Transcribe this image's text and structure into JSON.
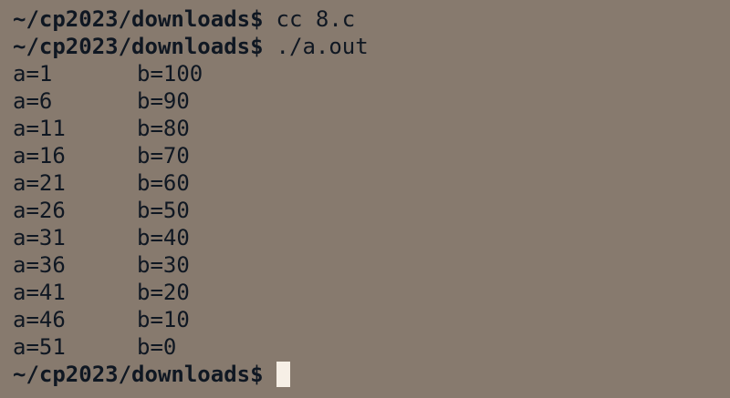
{
  "terminal": {
    "prompt": "~/cp2023/downloads$",
    "commands": [
      "cc 8.c",
      "./a.out"
    ],
    "output": [
      {
        "a": "a=1",
        "b": "b=100"
      },
      {
        "a": "a=6",
        "b": "b=90"
      },
      {
        "a": "a=11",
        "b": "b=80"
      },
      {
        "a": "a=16",
        "b": "b=70"
      },
      {
        "a": "a=21",
        "b": "b=60"
      },
      {
        "a": "a=26",
        "b": "b=50"
      },
      {
        "a": "a=31",
        "b": "b=40"
      },
      {
        "a": "a=36",
        "b": "b=30"
      },
      {
        "a": "a=41",
        "b": "b=20"
      },
      {
        "a": "a=46",
        "b": "b=10"
      },
      {
        "a": "a=51",
        "b": "b=0"
      }
    ]
  },
  "colors": {
    "background": "#877a6e",
    "text": "#0f1722",
    "cursor": "#f6efe6"
  }
}
